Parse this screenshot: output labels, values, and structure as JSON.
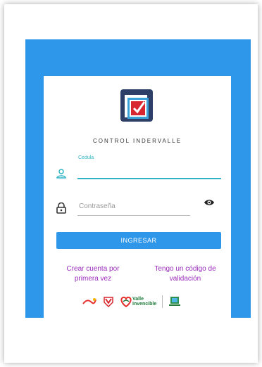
{
  "app": {
    "title": "CONTROL INDERVALLE"
  },
  "login": {
    "username_label": "Cedula",
    "username_value": "",
    "password_placeholder": "Contraseña",
    "submit_label": "INGRESAR"
  },
  "links": {
    "create_account": "Crear cuenta por primera vez",
    "validation_code": "Tengo un código de validación"
  },
  "partner_logos": {
    "valle_line1": "Valle",
    "valle_line2": "Invencible"
  },
  "colors": {
    "primary": "#2f97ea",
    "accent_teal": "#2fb3c6",
    "link_purple": "#9a2bbd"
  },
  "icons": [
    "user-icon",
    "lock-icon",
    "eye-icon",
    "app-logo-icon"
  ]
}
